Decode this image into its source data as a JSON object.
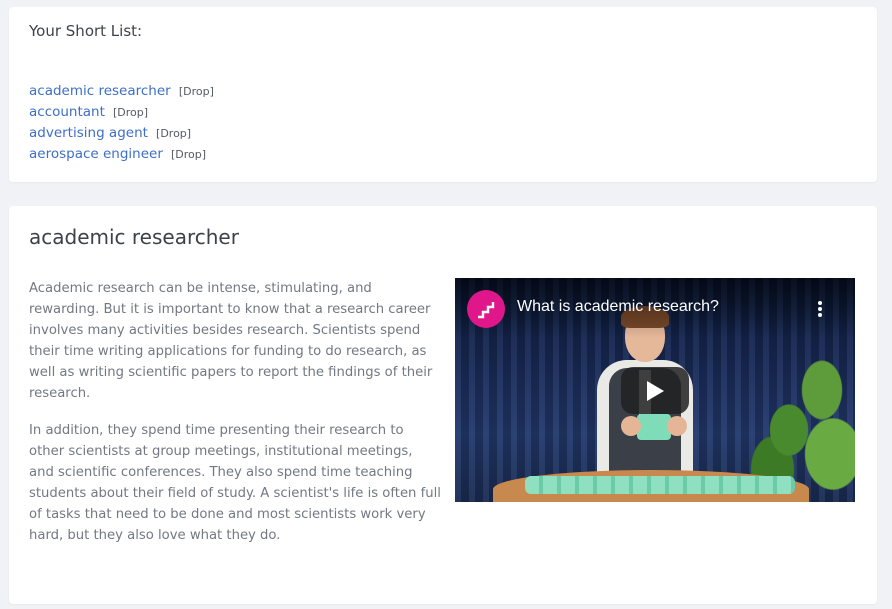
{
  "shortlist": {
    "title": "Your Short List:",
    "drop_label": "[Drop]",
    "items": [
      {
        "label": "academic researcher"
      },
      {
        "label": "accountant"
      },
      {
        "label": "advertising agent"
      },
      {
        "label": "aerospace engineer"
      }
    ]
  },
  "career": {
    "title": "academic researcher",
    "paragraphs": [
      "Academic research can be intense, stimulating, and rewarding. But it is important to know that a research career involves many activities besides research. Scientists spend their time writing applications for funding to do research, as well as writing scientific papers to report the findings of their research.",
      "In addition, they spend time presenting their research to other scientists at group meetings, institutional meetings, and scientific conferences. They also spend time teaching students about their field of study. A scientist's life is often full of tasks that need to be done and most scientists work very hard, but they also love what they do."
    ],
    "video": {
      "title": "What is academic research?",
      "channel_icon": "staircase-logo-icon",
      "menu_icon": "more-vertical-icon",
      "play_icon": "play-icon"
    }
  },
  "colors": {
    "link": "#3d6fc6",
    "text": "#737882",
    "heading": "#3d4149",
    "channel_logo": "#e0178b",
    "page_bg": "#f1f2f5"
  }
}
